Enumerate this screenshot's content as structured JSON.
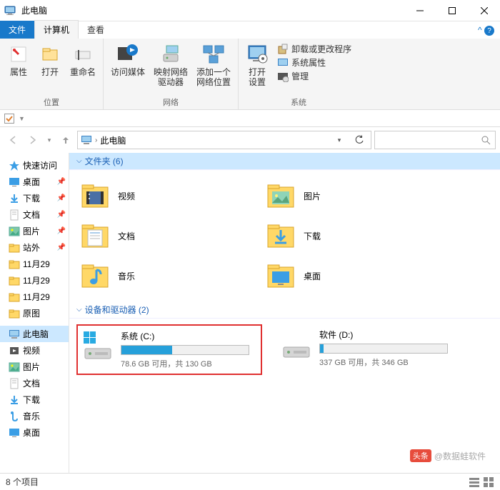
{
  "window": {
    "title": "此电脑"
  },
  "tabs": {
    "file": "文件",
    "computer": "计算机",
    "view": "查看"
  },
  "ribbon": {
    "group_location": {
      "label": "位置",
      "properties": "属性",
      "open": "打开",
      "rename": "重命名"
    },
    "group_network": {
      "label": "网络",
      "media": "访问媒体",
      "map": "映射网络\n驱动器",
      "addloc": "添加一个\n网络位置"
    },
    "group_system": {
      "label": "系统",
      "opensettings": "打开\n设置",
      "uninstall": "卸载或更改程序",
      "sysprops": "系统属性",
      "manage": "管理"
    }
  },
  "addressbar": {
    "root": "此电脑"
  },
  "sidebar": {
    "quick": "快速访问",
    "items": [
      {
        "label": "桌面",
        "pin": true
      },
      {
        "label": "下载",
        "pin": true
      },
      {
        "label": "文档",
        "pin": true
      },
      {
        "label": "图片",
        "pin": true
      },
      {
        "label": "站外",
        "pin": true
      },
      {
        "label": "11月29"
      },
      {
        "label": "11月29"
      },
      {
        "label": "11月29"
      },
      {
        "label": "原图"
      }
    ],
    "thispc": "此电脑",
    "pcitems": [
      {
        "label": "视频"
      },
      {
        "label": "图片"
      },
      {
        "label": "文档"
      },
      {
        "label": "下载"
      },
      {
        "label": "音乐"
      },
      {
        "label": "桌面"
      }
    ]
  },
  "groups": {
    "folders": {
      "label": "文件夹 (6)",
      "items": [
        {
          "name": "视频",
          "icon": "video"
        },
        {
          "name": "图片",
          "icon": "pictures"
        },
        {
          "name": "文档",
          "icon": "documents"
        },
        {
          "name": "下载",
          "icon": "downloads"
        },
        {
          "name": "音乐",
          "icon": "music"
        },
        {
          "name": "桌面",
          "icon": "desktop"
        }
      ]
    },
    "drives": {
      "label": "设备和驱动器 (2)",
      "items": [
        {
          "name": "系统 (C:)",
          "free": "78.6 GB 可用，共 130 GB",
          "fillpct": 40,
          "highlight": true
        },
        {
          "name": "软件 (D:)",
          "free": "337 GB 可用，共 346 GB",
          "fillpct": 3
        }
      ]
    }
  },
  "statusbar": {
    "count": "8 个项目"
  },
  "watermark": {
    "prefix": "头条",
    "text": "@数据蛙软件"
  }
}
